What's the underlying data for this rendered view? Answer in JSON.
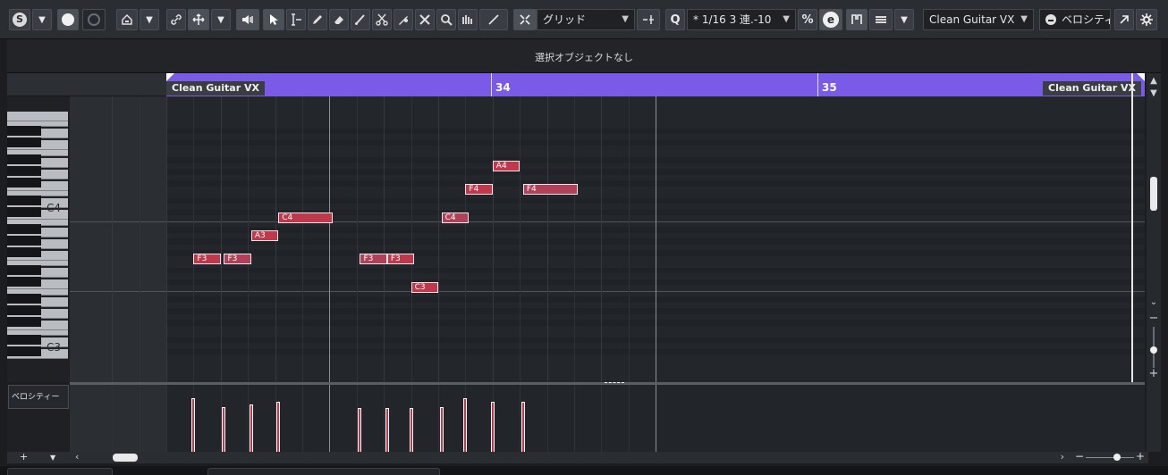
{
  "toolbar": {
    "snap_type": "グリッド",
    "quantize": "* 1/16  3 連.-10",
    "part_select": "Clean Guitar VX",
    "lane_select": "ベロシティー"
  },
  "info_line": {
    "no_selection": "選択オブジェクトなし"
  },
  "ruler": {
    "part_name_left": "Clean Guitar VX",
    "part_name_right": "Clean Guitar VX",
    "bars": [
      "34",
      "35"
    ]
  },
  "keyboard": {
    "labels": [
      "C4",
      "C3"
    ]
  },
  "notes": [
    {
      "pitch": "F3",
      "start": 0.5,
      "length": 0.5,
      "velocity": 0.83
    },
    {
      "pitch": "F3",
      "start": 1.06,
      "length": 0.5,
      "velocity": 0.7
    },
    {
      "pitch": "A3",
      "start": 1.56,
      "length": 0.5,
      "velocity": 0.73
    },
    {
      "pitch": "C4",
      "start": 2.06,
      "length": 1.0,
      "velocity": 0.78
    },
    {
      "pitch": "F3",
      "start": 3.56,
      "length": 0.5,
      "velocity": 0.68
    },
    {
      "pitch": "F3",
      "start": 4.06,
      "length": 0.5,
      "velocity": 0.68
    },
    {
      "pitch": "C3",
      "start": 4.5,
      "length": 0.5,
      "velocity": 0.68
    },
    {
      "pitch": "C4",
      "start": 5.06,
      "length": 0.5,
      "velocity": 0.7
    },
    {
      "pitch": "F4",
      "start": 5.5,
      "length": 0.5,
      "velocity": 0.83
    },
    {
      "pitch": "A4",
      "start": 6.0,
      "length": 0.5,
      "velocity": 0.78
    },
    {
      "pitch": "F4",
      "start": 6.56,
      "length": 1.0,
      "velocity": 0.78
    }
  ],
  "controller_lane": {
    "name": "ベロシティー"
  },
  "colors": {
    "part": "#7a5be8",
    "note": "#c2374a"
  }
}
